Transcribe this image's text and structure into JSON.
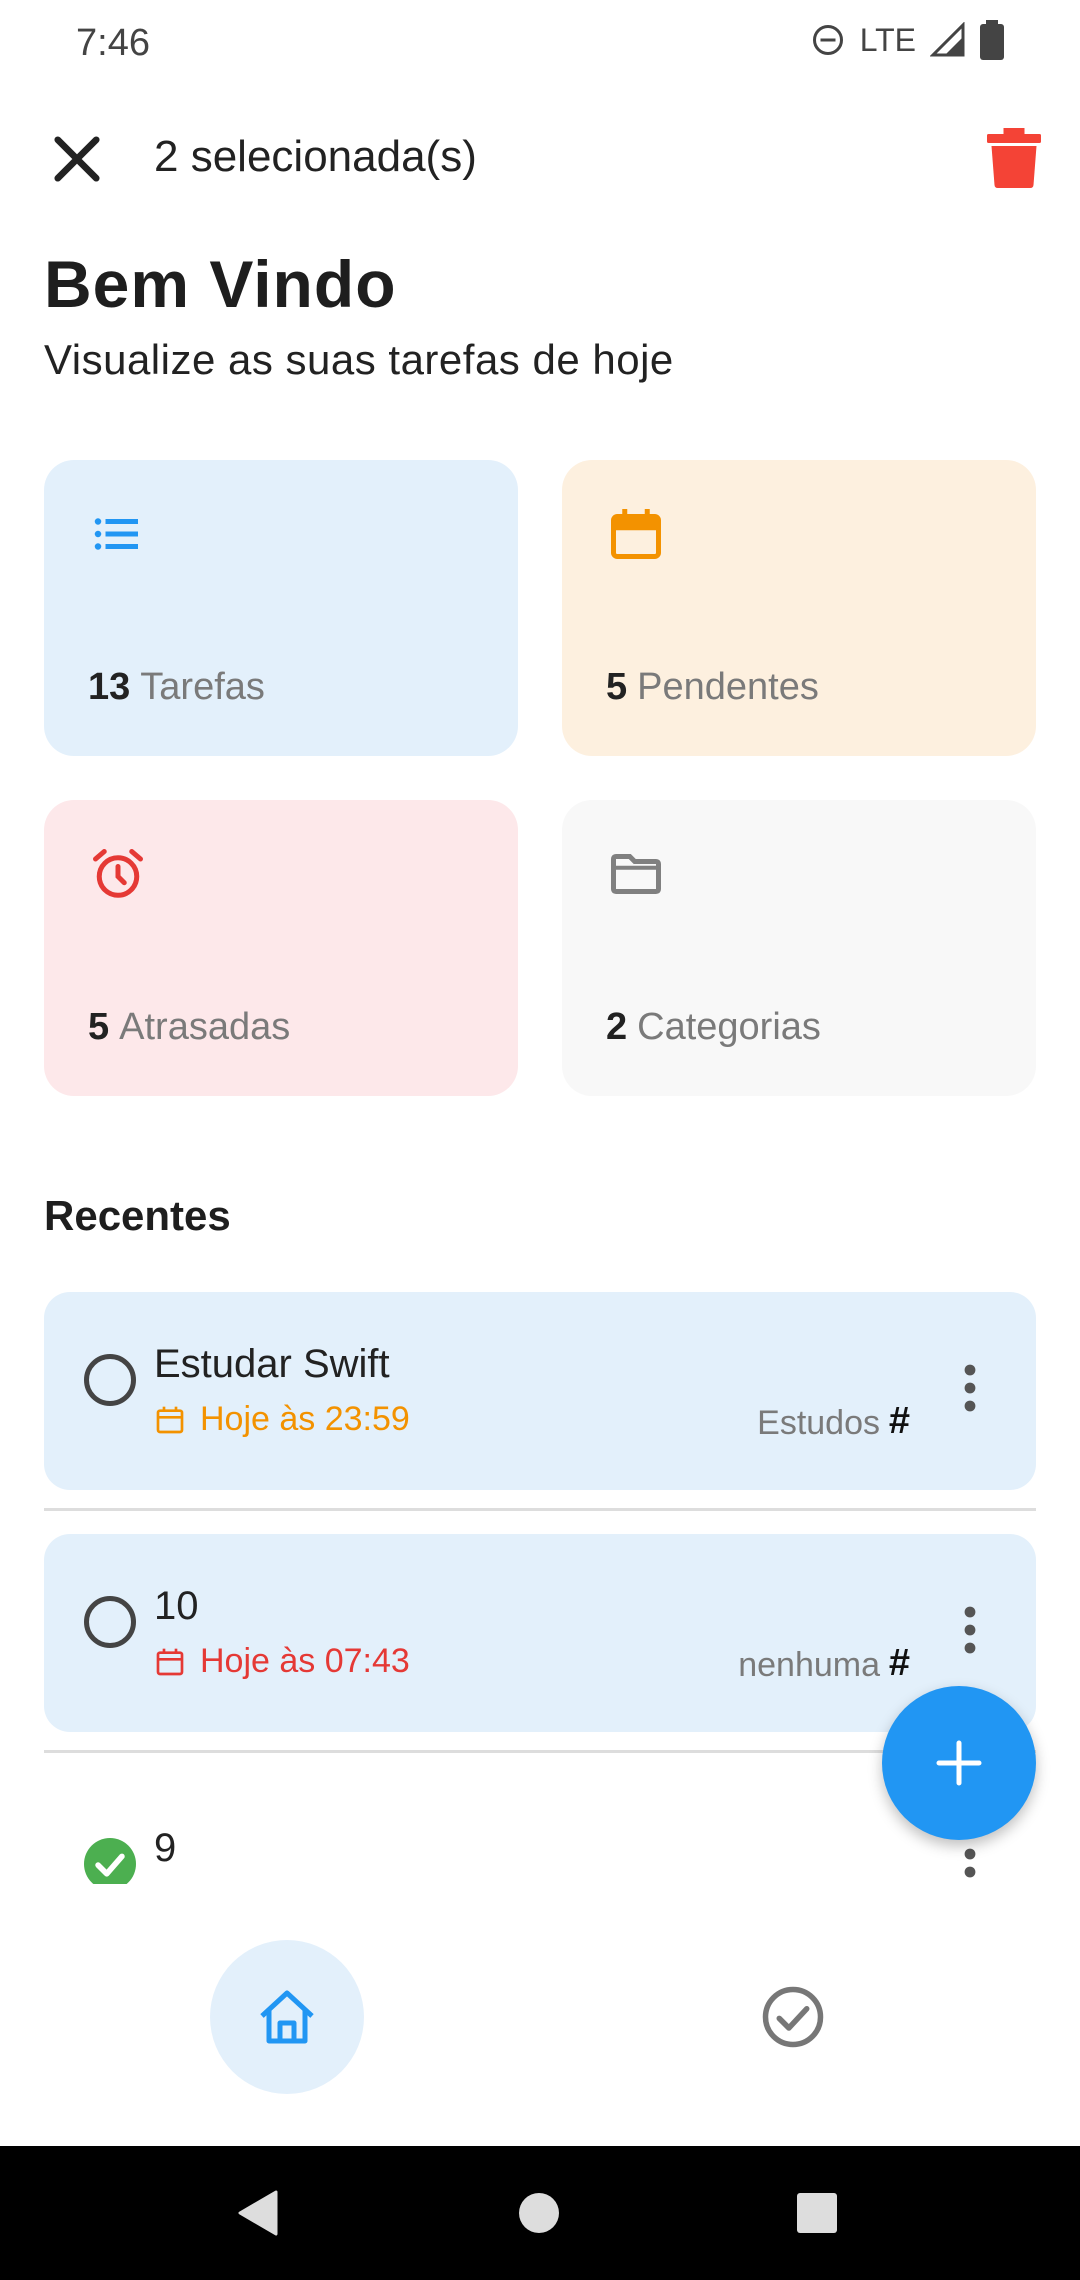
{
  "status_bar": {
    "time": "7:46",
    "network": "LTE"
  },
  "top_bar": {
    "selected_label": "2 selecionada(s)"
  },
  "header": {
    "title": "Bem Vindo",
    "subtitle": "Visualize as suas tarefas de hoje"
  },
  "cards": [
    {
      "count": "13",
      "label": "Tarefas",
      "icon": "list-icon",
      "bg": "#e3f0fb",
      "icon_color": "#2196f3"
    },
    {
      "count": "5",
      "label": "Pendentes",
      "icon": "calendar-icon",
      "bg": "#fdf0df",
      "icon_color": "#f39200"
    },
    {
      "count": "5",
      "label": "Atrasadas",
      "icon": "alarm-icon",
      "bg": "#fde8ea",
      "icon_color": "#e53935"
    },
    {
      "count": "2",
      "label": "Categorias",
      "icon": "folder-icon",
      "bg": "#f8f8f8",
      "icon_color": "#808080"
    }
  ],
  "recent": {
    "title": "Recentes",
    "items": [
      {
        "name": "Estudar Swift",
        "date": "Hoje às 23:59",
        "date_color": "#f39200",
        "category": "Estudos",
        "hash": "#",
        "done": false
      },
      {
        "name": "10",
        "date": "Hoje às 07:43",
        "date_color": "#e53935",
        "category": "nenhuma",
        "hash": "#",
        "done": false
      },
      {
        "name": "9",
        "done": true
      }
    ]
  },
  "colors": {
    "accent": "#2196f3",
    "danger": "#f44336",
    "success": "#4caf50"
  }
}
